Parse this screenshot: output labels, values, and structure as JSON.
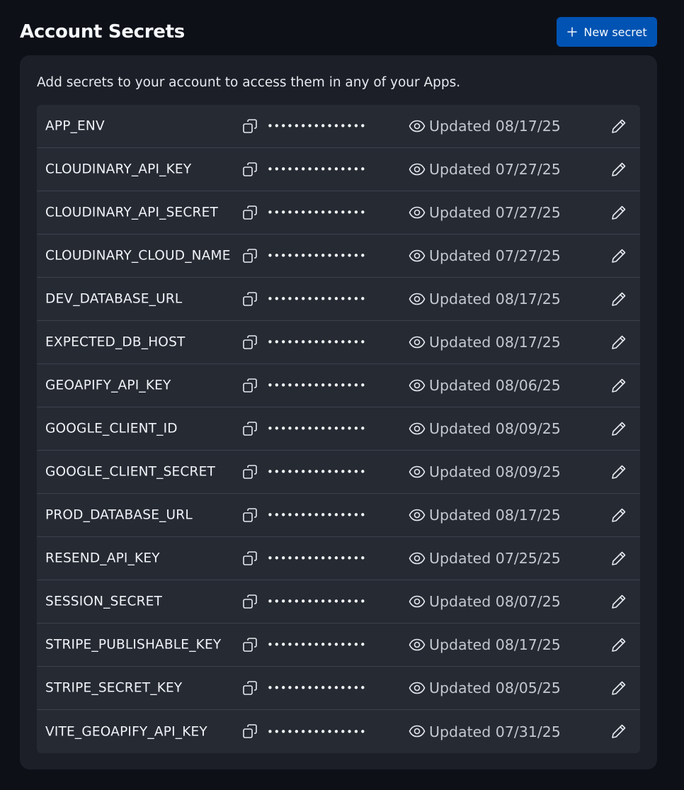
{
  "header": {
    "title": "Account Secrets",
    "new_secret_label": "New secret"
  },
  "panel": {
    "description": "Add secrets to your account to access them in any of your Apps."
  },
  "secrets": [
    {
      "key": "APP_ENV",
      "masked": "•••••••••••••••",
      "updated": "Updated 08/17/25"
    },
    {
      "key": "CLOUDINARY_API_KEY",
      "masked": "•••••••••••••••",
      "updated": "Updated 07/27/25"
    },
    {
      "key": "CLOUDINARY_API_SECRET",
      "masked": "•••••••••••••••",
      "updated": "Updated 07/27/25"
    },
    {
      "key": "CLOUDINARY_CLOUD_NAME",
      "masked": "•••••••••••••••",
      "updated": "Updated 07/27/25"
    },
    {
      "key": "DEV_DATABASE_URL",
      "masked": "•••••••••••••••",
      "updated": "Updated 08/17/25"
    },
    {
      "key": "EXPECTED_DB_HOST",
      "masked": "•••••••••••••••",
      "updated": "Updated 08/17/25"
    },
    {
      "key": "GEOAPIFY_API_KEY",
      "masked": "•••••••••••••••",
      "updated": "Updated 08/06/25"
    },
    {
      "key": "GOOGLE_CLIENT_ID",
      "masked": "•••••••••••••••",
      "updated": "Updated 08/09/25"
    },
    {
      "key": "GOOGLE_CLIENT_SECRET",
      "masked": "•••••••••••••••",
      "updated": "Updated 08/09/25"
    },
    {
      "key": "PROD_DATABASE_URL",
      "masked": "•••••••••••••••",
      "updated": "Updated 08/17/25"
    },
    {
      "key": "RESEND_API_KEY",
      "masked": "•••••••••••••••",
      "updated": "Updated 07/25/25"
    },
    {
      "key": "SESSION_SECRET",
      "masked": "•••••••••••••••",
      "updated": "Updated 08/07/25"
    },
    {
      "key": "STRIPE_PUBLISHABLE_KEY",
      "masked": "•••••••••••••••",
      "updated": "Updated 08/17/25"
    },
    {
      "key": "STRIPE_SECRET_KEY",
      "masked": "•••••••••••••••",
      "updated": "Updated 08/05/25"
    },
    {
      "key": "VITE_GEOAPIFY_API_KEY",
      "masked": "•••••••••••••••",
      "updated": "Updated 07/31/25"
    }
  ],
  "icons": {
    "new": "plus-icon",
    "copy": "copy-icon",
    "reveal": "eye-icon",
    "edit": "pencil-icon"
  },
  "colors": {
    "page_background": "#0e1018",
    "panel_background": "#1c1f27",
    "row_background": "#262a33",
    "primary_button": "#0053b3"
  }
}
